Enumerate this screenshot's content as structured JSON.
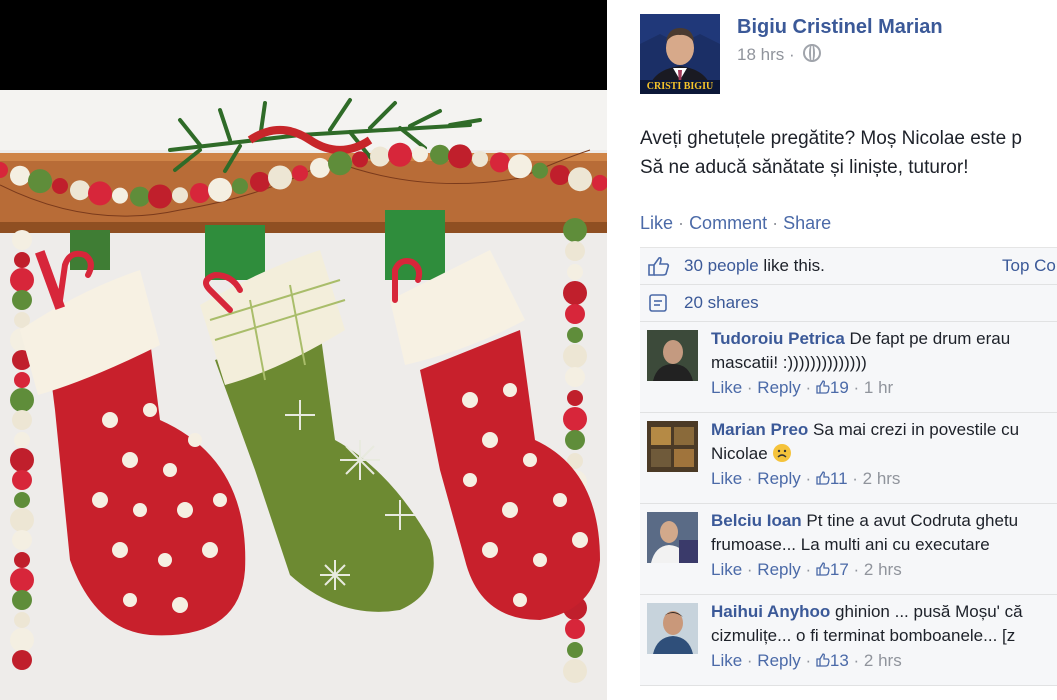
{
  "post": {
    "author": "Bigiu Cristinel Marian",
    "avatar_caption": "CRISTI BIGIU",
    "time": "18 hrs",
    "privacy_icon": "globe-icon",
    "text_line1": "Aveți ghetuțele pregătite? Moș Nicolae este p",
    "text_line2": "Să ne aducă sănătate și liniște, tuturor!"
  },
  "actions": {
    "like": "Like",
    "comment": "Comment",
    "share": "Share",
    "sep": "·"
  },
  "feedback": {
    "likes_count": "30 people",
    "likes_suffix": " like this.",
    "top_comments": "Top Co",
    "shares": "20 shares"
  },
  "comments": [
    {
      "name": "Tudoroiu Petrica",
      "text1": "De fapt pe drum erau",
      "text2": "mascatii! :))))))))))))))",
      "like": "Like",
      "reply": "Reply",
      "likes": "19",
      "time": "1 hr"
    },
    {
      "name": "Marian Preo",
      "text1": "Sa mai crezi in povestile cu",
      "text2": "Nicolae",
      "like": "Like",
      "reply": "Reply",
      "likes": "11",
      "time": "2 hrs"
    },
    {
      "name": "Belciu Ioan",
      "text1": "Pt tine a avut Codruta ghetu",
      "text2": "frumoase... La multi ani cu executare",
      "like": "Like",
      "reply": "Reply",
      "likes": "17",
      "time": "2 hrs"
    },
    {
      "name": "Haihui Anyhoo",
      "text1": "ghinion ... pusă Moșu' că",
      "text2": "cizmulițe... o fi terminat bomboanele... [z",
      "like": "Like",
      "reply": "Reply",
      "likes": "13",
      "time": "2 hrs"
    }
  ],
  "colors": {
    "link": "#3b5998",
    "meta": "#90949c",
    "feedback_bg": "#f6f7f9"
  }
}
